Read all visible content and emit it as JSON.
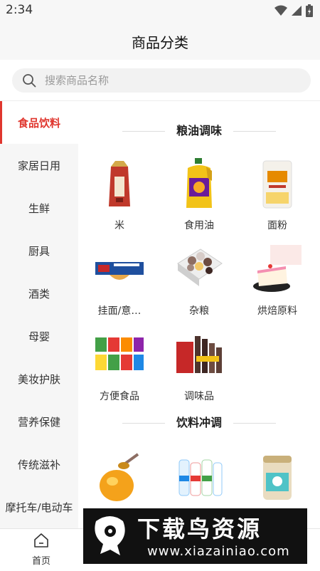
{
  "status_bar": {
    "time": "2:34"
  },
  "header": {
    "title": "商品分类"
  },
  "search": {
    "placeholder": "搜索商品名称"
  },
  "sidebar": {
    "items": [
      {
        "label": "食品饮料",
        "active": true
      },
      {
        "label": "家居日用"
      },
      {
        "label": "生鲜"
      },
      {
        "label": "厨具"
      },
      {
        "label": "酒类"
      },
      {
        "label": "母婴"
      },
      {
        "label": "美妆护肤"
      },
      {
        "label": "营养保健"
      },
      {
        "label": "传统滋补"
      },
      {
        "label": "摩托车/电动车"
      }
    ]
  },
  "sections": [
    {
      "title": "粮油调味",
      "items": [
        {
          "label": "米",
          "icon": "rice-bag-icon"
        },
        {
          "label": "食用油",
          "icon": "oil-bottle-icon"
        },
        {
          "label": "面粉",
          "icon": "flour-bag-icon"
        },
        {
          "label": "挂面/意…",
          "icon": "pasta-box-icon"
        },
        {
          "label": "杂粮",
          "icon": "grains-tray-icon"
        },
        {
          "label": "烘焙原料",
          "icon": "cake-icon"
        },
        {
          "label": "方便食品",
          "icon": "instant-noodles-icon"
        },
        {
          "label": "调味品",
          "icon": "condiments-icon"
        }
      ]
    },
    {
      "title": "饮料冲调",
      "items": [
        {
          "label": "",
          "icon": "honey-jar-icon"
        },
        {
          "label": "",
          "icon": "milk-bottles-icon"
        },
        {
          "label": "",
          "icon": "milk-powder-can-icon"
        }
      ]
    }
  ],
  "bottom_nav": {
    "items": [
      {
        "label": "首页",
        "icon": "home-icon"
      }
    ]
  },
  "watermark": {
    "title": "下载鸟资源",
    "url": "www.xiazainiao.com"
  },
  "colors": {
    "accent": "#e0362e",
    "sidebar_bg": "#f6f6f6",
    "header_bg": "#f7f7f7"
  }
}
